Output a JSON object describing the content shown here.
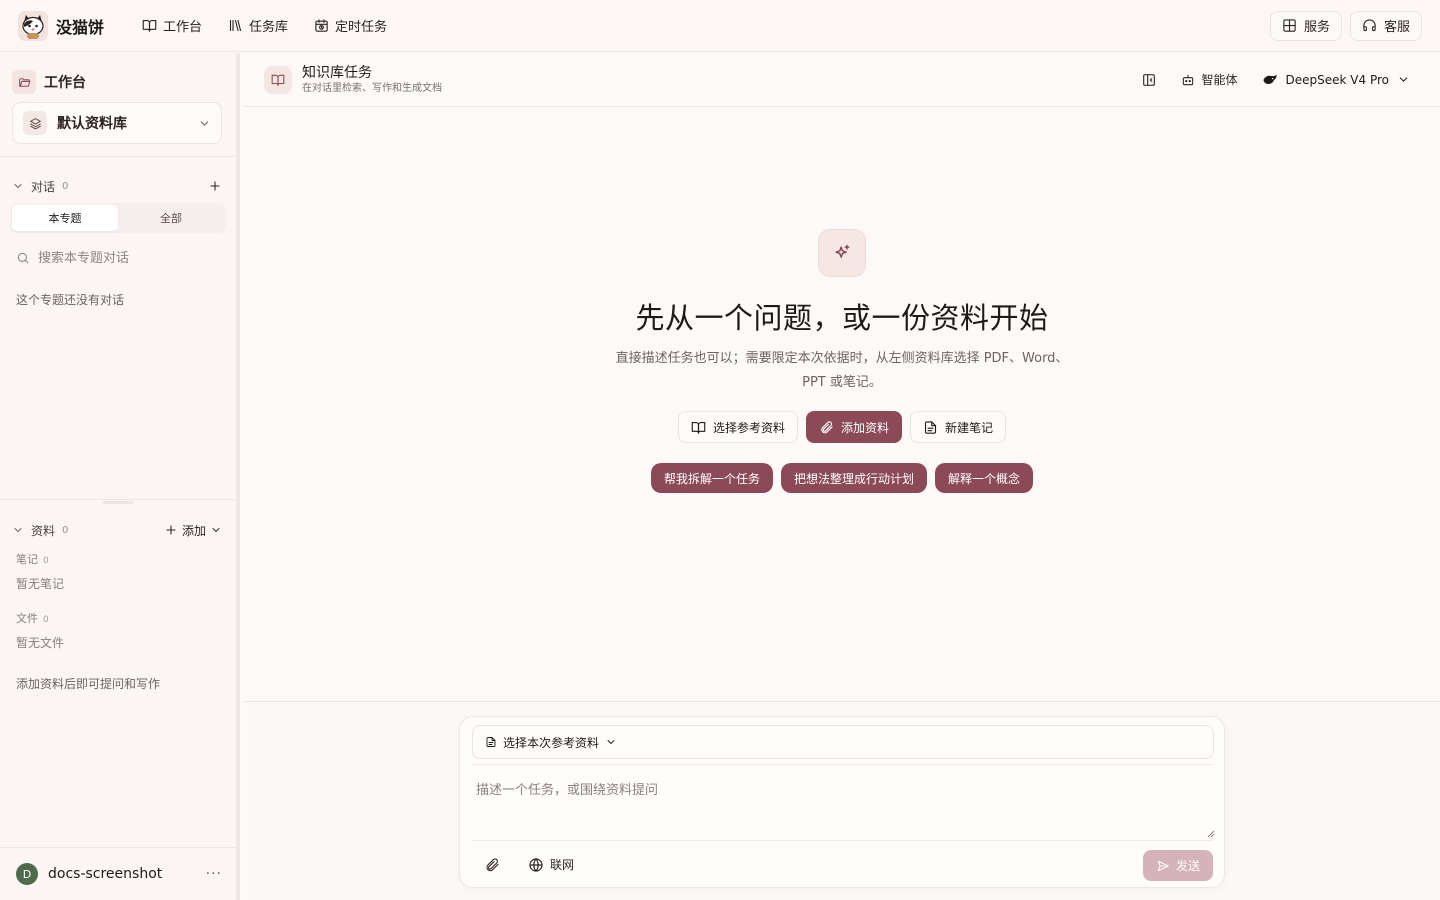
{
  "brand": {
    "name": "没猫饼",
    "logo_icon": "cat-logo"
  },
  "topnav": {
    "items": [
      {
        "label": "工作台",
        "icon": "book-open-icon"
      },
      {
        "label": "任务库",
        "icon": "library-icon"
      },
      {
        "label": "定时任务",
        "icon": "calendar-clock-icon"
      }
    ],
    "right": [
      {
        "label": "服务",
        "icon": "grid-icon"
      },
      {
        "label": "客服",
        "icon": "headset-icon"
      }
    ]
  },
  "sidebar": {
    "title": "工作台",
    "kb_select": "默认资料库",
    "conversations": {
      "title": "对话",
      "count": "0"
    },
    "tabs": [
      "本专题",
      "全部"
    ],
    "search_placeholder": "搜索本专题对话",
    "empty": "这个专题还没有对话",
    "materials": {
      "title": "资料",
      "count": "0",
      "add_label": "添加"
    },
    "notes": {
      "title": "笔记",
      "count": "0",
      "empty": "暂无笔记"
    },
    "files": {
      "title": "文件",
      "count": "0",
      "empty": "暂无文件"
    },
    "hint": "添加资料后即可提问和写作",
    "user": {
      "initial": "D",
      "name": "docs-screenshot",
      "more": "···"
    }
  },
  "main": {
    "header": {
      "title": "知识库任务",
      "subtitle": "在对话里检索、写作和生成文档",
      "agent_label": "智能体",
      "model_label": "DeepSeek V4 Pro"
    },
    "hero": {
      "title": "先从一个问题，或一份资料开始",
      "desc": "直接描述任务也可以；需要限定本次依据时，从左侧资料库选择 PDF、Word、PPT 或笔记。",
      "actions": [
        "选择参考资料",
        "添加资料",
        "新建笔记"
      ],
      "chips": [
        "帮我拆解一个任务",
        "把想法整理成行动计划",
        "解释一个概念"
      ]
    },
    "composer": {
      "ref_select": "选择本次参考资料",
      "placeholder": "描述一个任务，或围绕资料提问",
      "web_label": "联网",
      "send_label": "发送"
    }
  },
  "colors": {
    "accent": "#8c4a58",
    "send_disabled": "#d4b3ba",
    "background": "#fdf9f8"
  }
}
